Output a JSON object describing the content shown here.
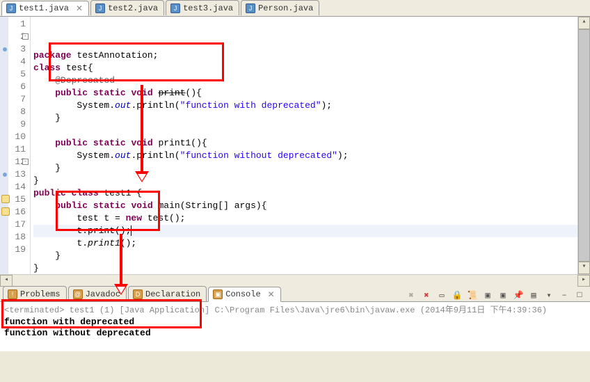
{
  "editorTabs": [
    {
      "label": "test1.java",
      "active": true,
      "closeable": true
    },
    {
      "label": "test2.java",
      "active": false,
      "closeable": false
    },
    {
      "label": "test3.java",
      "active": false,
      "closeable": false
    },
    {
      "label": "Person.java",
      "active": false,
      "closeable": false
    }
  ],
  "code": {
    "lines": [
      {
        "n": 1,
        "tokens": [
          [
            "kw",
            "package"
          ],
          [
            "",
            " testAnnotation;"
          ]
        ]
      },
      {
        "n": 2,
        "fold": true,
        "tokens": [
          [
            "kw",
            "class"
          ],
          [
            "",
            " test{"
          ]
        ]
      },
      {
        "n": 3,
        "dot": true,
        "tokens": [
          [
            "",
            "    "
          ],
          [
            "ann",
            "@Deprecated"
          ]
        ]
      },
      {
        "n": 4,
        "tokens": [
          [
            "",
            "    "
          ],
          [
            "kw",
            "public"
          ],
          [
            "",
            " "
          ],
          [
            "kw",
            "static"
          ],
          [
            "",
            " "
          ],
          [
            "kw",
            "void"
          ],
          [
            "",
            " "
          ],
          [
            "dep",
            "print"
          ],
          [
            "",
            "(){"
          ]
        ]
      },
      {
        "n": 5,
        "tokens": [
          [
            "",
            "        System."
          ],
          [
            "sf",
            "out"
          ],
          [
            "",
            ".println("
          ],
          [
            "str",
            "\"function with deprecated\""
          ],
          [
            "",
            ");"
          ]
        ]
      },
      {
        "n": 6,
        "tokens": [
          [
            "",
            "    }"
          ]
        ]
      },
      {
        "n": 7,
        "tokens": [
          [
            "",
            ""
          ]
        ]
      },
      {
        "n": 8,
        "tokens": [
          [
            "",
            "    "
          ],
          [
            "kw",
            "public"
          ],
          [
            "",
            " "
          ],
          [
            "kw",
            "static"
          ],
          [
            "",
            " "
          ],
          [
            "kw",
            "void"
          ],
          [
            "",
            " print1(){"
          ]
        ]
      },
      {
        "n": 9,
        "tokens": [
          [
            "",
            "        System."
          ],
          [
            "sf",
            "out"
          ],
          [
            "",
            ".println("
          ],
          [
            "str",
            "\"function without deprecated\""
          ],
          [
            "",
            ");"
          ]
        ]
      },
      {
        "n": 10,
        "tokens": [
          [
            "",
            "    }"
          ]
        ]
      },
      {
        "n": 11,
        "tokens": [
          [
            "",
            "}"
          ]
        ]
      },
      {
        "n": 12,
        "fold": true,
        "tokens": [
          [
            "kw",
            "public"
          ],
          [
            "",
            " "
          ],
          [
            "kw",
            "class"
          ],
          [
            "",
            " test1 {"
          ]
        ]
      },
      {
        "n": 13,
        "dot": true,
        "tokens": [
          [
            "",
            "    "
          ],
          [
            "kw",
            "public"
          ],
          [
            "",
            " "
          ],
          [
            "kw",
            "static"
          ],
          [
            "",
            " "
          ],
          [
            "kw",
            "void"
          ],
          [
            "",
            " main(String[] args){"
          ]
        ]
      },
      {
        "n": 14,
        "tokens": [
          [
            "",
            "        test t = "
          ],
          [
            "kw",
            "new"
          ],
          [
            "",
            " test();"
          ]
        ]
      },
      {
        "n": 15,
        "marker": true,
        "hl": true,
        "cursor": true,
        "tokens": [
          [
            "",
            "        t."
          ],
          [
            "dep",
            "print"
          ],
          [
            "",
            "();"
          ]
        ]
      },
      {
        "n": 16,
        "marker": true,
        "tokens": [
          [
            "",
            "        t."
          ],
          [
            "it",
            "print1"
          ],
          [
            "",
            "();"
          ]
        ]
      },
      {
        "n": 17,
        "tokens": [
          [
            "",
            "    }"
          ]
        ]
      },
      {
        "n": 18,
        "tokens": [
          [
            "",
            "}"
          ]
        ]
      },
      {
        "n": 19,
        "tokens": [
          [
            "",
            ""
          ]
        ]
      }
    ]
  },
  "bottomTabs": [
    {
      "label": "Problems",
      "icon": "problems-icon"
    },
    {
      "label": "Javadoc",
      "icon": "javadoc-icon"
    },
    {
      "label": "Declaration",
      "icon": "declaration-icon"
    },
    {
      "label": "Console",
      "icon": "console-icon",
      "active": true,
      "closeable": true
    }
  ],
  "console": {
    "header": "<terminated> test1 (1) [Java Application] C:\\Program Files\\Java\\jre6\\bin\\javaw.exe (2014年9月11日 下午4:39:36)",
    "lines": [
      "function with deprecated",
      "function without deprecated"
    ]
  },
  "toolbarIcons": [
    "x-gray",
    "x-red",
    "eraser",
    "lock",
    "scroll",
    "terminal-new",
    "terminal-pin",
    "pin",
    "page",
    "dropdown",
    "minimize",
    "maximize"
  ]
}
